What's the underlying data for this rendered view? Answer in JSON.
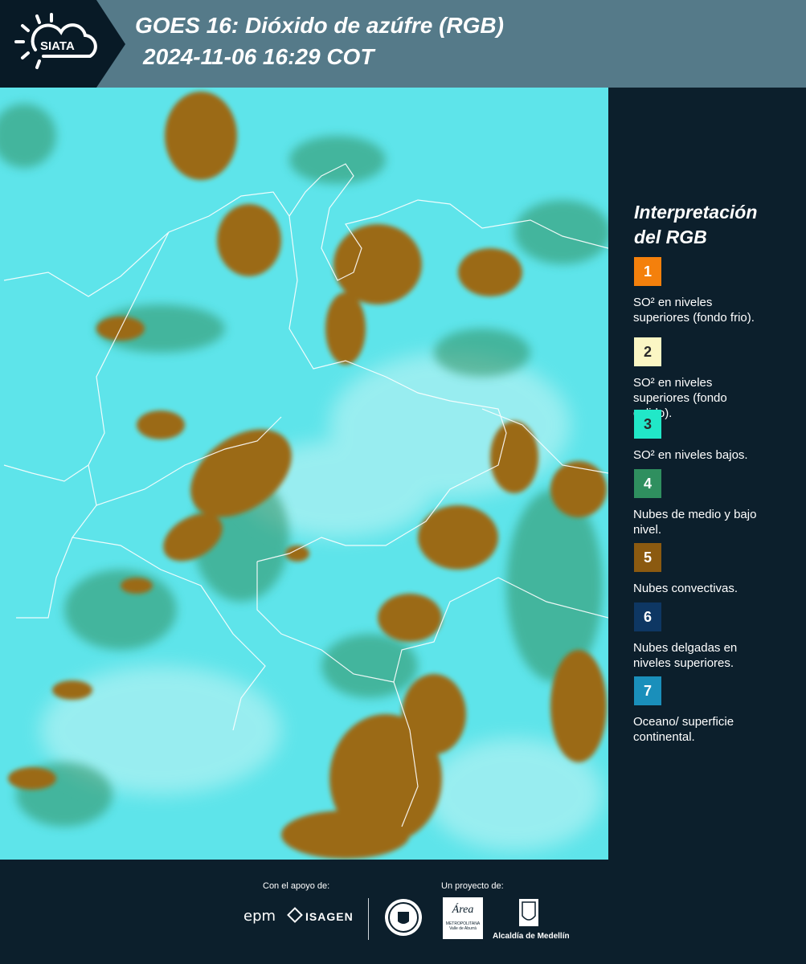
{
  "header": {
    "logo_text": "SIATA",
    "title_line1": "GOES 16: Dióxido de azúfre (RGB)",
    "title_line2": "2024-11-06 16:29 COT"
  },
  "legend": {
    "title_line1": "Interpretación",
    "title_line2": "del RGB",
    "items": [
      {
        "number": "1",
        "color": "#f4800c",
        "line1": "SO² en niveles",
        "line2": "superiores (fondo frio).",
        "line3": ""
      },
      {
        "number": "2",
        "color": "#fbf6c4",
        "line1": "SO² en niveles",
        "line2": "superiores (fondo",
        "line3": "calido)."
      },
      {
        "number": "3",
        "color": "#21e8c8",
        "line1": "SO² en niveles bajos.",
        "line2": "",
        "line3": ""
      },
      {
        "number": "4",
        "color": "#2f8f5f",
        "line1": "Nubes de medio y bajo",
        "line2": "nivel.",
        "line3": ""
      },
      {
        "number": "5",
        "color": "#8b5a10",
        "line1": "Nubes convectivas.",
        "line2": "",
        "line3": ""
      },
      {
        "number": "6",
        "color": "#0e3763",
        "line1": "Nubes delgadas en",
        "line2": "niveles superiores.",
        "line3": ""
      },
      {
        "number": "7",
        "color": "#1a8fbb",
        "line1": "Oceano/ superficie",
        "line2": "continental.",
        "line3": ""
      }
    ]
  },
  "footer": {
    "support_label": "Con el apoyo de:",
    "project_label": "Un proyecto de:",
    "sponsors": [
      "epm",
      "ISAGEN"
    ],
    "partners": [
      "Área Metropolitana Valle de Aburrá",
      "Alcaldía de Medellín"
    ],
    "area_logo_text": "Área",
    "area_logo_sub1": "METROPOLITANA",
    "area_logo_sub2": "Valle de Aburrá",
    "alcaldia_text": "Alcaldía de Medellín"
  },
  "colors": {
    "header_band": "#557a89",
    "background": "#0c1f2c",
    "map_surface": "#5ee4ea",
    "convective_clouds": "#8b5a10",
    "mid_low_clouds": "#2f8f5f"
  }
}
